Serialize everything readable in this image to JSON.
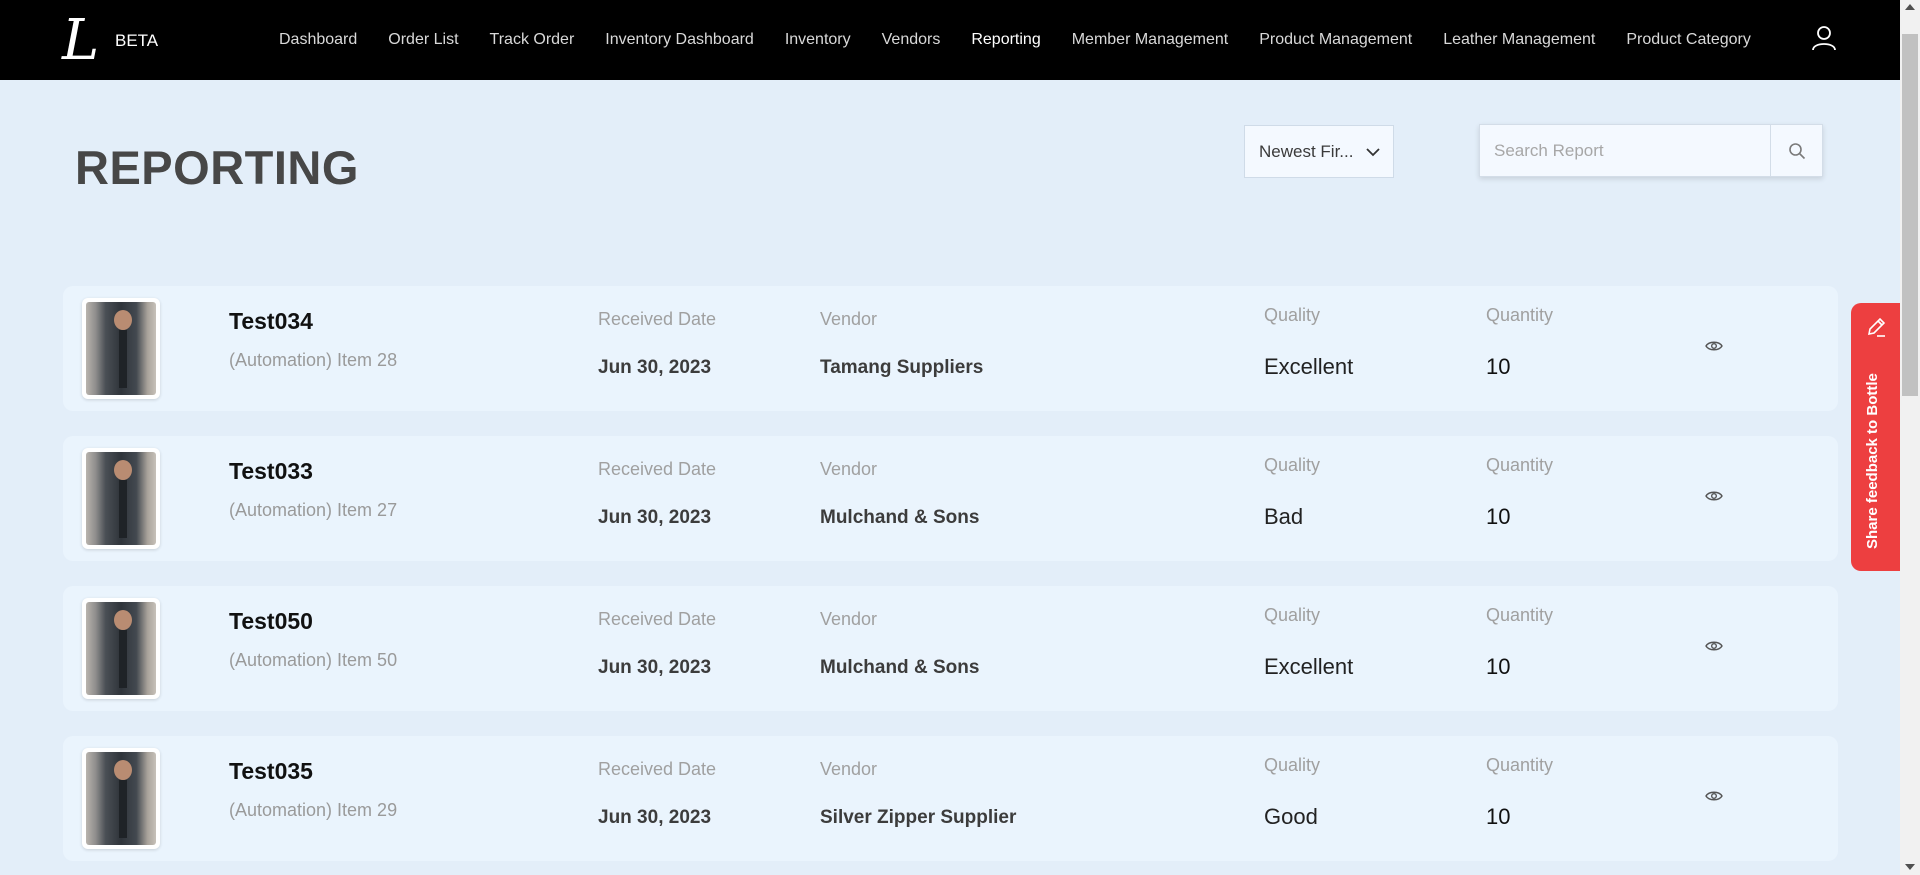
{
  "app": {
    "logo_letter": "L",
    "logo_badge": "BETA"
  },
  "nav": {
    "items": [
      {
        "label": "Dashboard",
        "active": false
      },
      {
        "label": "Order List",
        "active": false
      },
      {
        "label": "Track Order",
        "active": false
      },
      {
        "label": "Inventory Dashboard",
        "active": false
      },
      {
        "label": "Inventory",
        "active": false
      },
      {
        "label": "Vendors",
        "active": false
      },
      {
        "label": "Reporting",
        "active": true
      },
      {
        "label": "Member Management",
        "active": false
      },
      {
        "label": "Product Management",
        "active": false
      },
      {
        "label": "Leather Management",
        "active": false
      },
      {
        "label": "Product Category",
        "active": false
      }
    ],
    "user_icon": "user-icon"
  },
  "page": {
    "title": "REPORTING"
  },
  "sort": {
    "selected": "Newest Fir...",
    "icon": "chevron-down-icon"
  },
  "search": {
    "placeholder": "Search Report",
    "value": "",
    "icon": "search-icon"
  },
  "report_labels": {
    "received_date": "Received Date",
    "vendor": "Vendor",
    "quality": "Quality",
    "quantity": "Quantity"
  },
  "reports": [
    {
      "code": "Test034",
      "name": "(Automation) Item 28",
      "received_date": "Jun 30, 2023",
      "vendor": "Tamang Suppliers",
      "quality": "Excellent",
      "quantity": "10"
    },
    {
      "code": "Test033",
      "name": "(Automation) Item 27",
      "received_date": "Jun 30, 2023",
      "vendor": "Mulchand & Sons",
      "quality": "Bad",
      "quantity": "10"
    },
    {
      "code": "Test050",
      "name": "(Automation) Item 50",
      "received_date": "Jun 30, 2023",
      "vendor": "Mulchand & Sons",
      "quality": "Excellent",
      "quantity": "10"
    },
    {
      "code": "Test035",
      "name": "(Automation) Item 29",
      "received_date": "Jun 30, 2023",
      "vendor": "Silver Zipper Supplier",
      "quality": "Good",
      "quantity": "10"
    }
  ],
  "feedback": {
    "label": "Share feedback to Bottle",
    "icon": "pencil-icon"
  },
  "colors": {
    "navbar_bg": "#000000",
    "page_bg": "#e3eef9",
    "card_bg": "#eaf4fd",
    "feedback_bg": "#ed3f40"
  }
}
